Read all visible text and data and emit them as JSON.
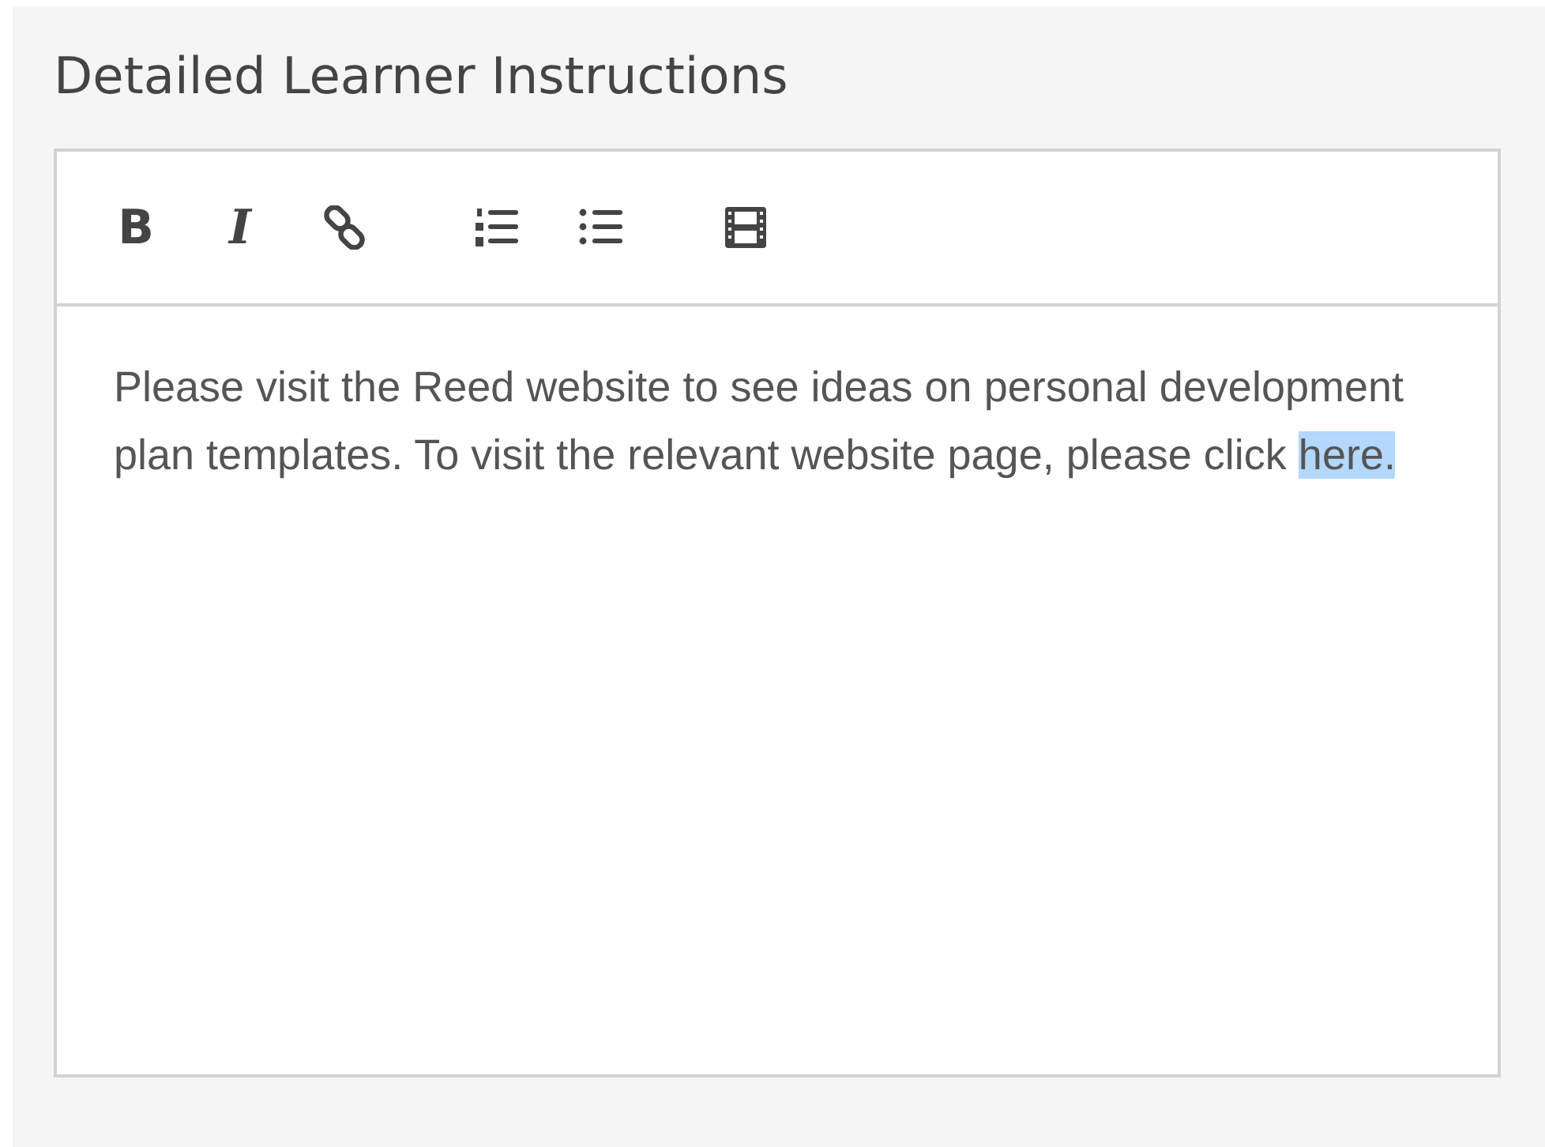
{
  "panel": {
    "title": "Detailed Learner Instructions"
  },
  "toolbar": [
    {
      "kind": "bold",
      "label": "B"
    },
    {
      "kind": "italic",
      "label": "I"
    },
    {
      "kind": "link"
    },
    {
      "kind": "ordered-list"
    },
    {
      "kind": "bullet-list"
    },
    {
      "kind": "video"
    }
  ],
  "editor": {
    "text": "Please visit the Reed website to see ideas on personal development plan templates. To visit the relevant website page, please click ",
    "selected_text": "here."
  }
}
